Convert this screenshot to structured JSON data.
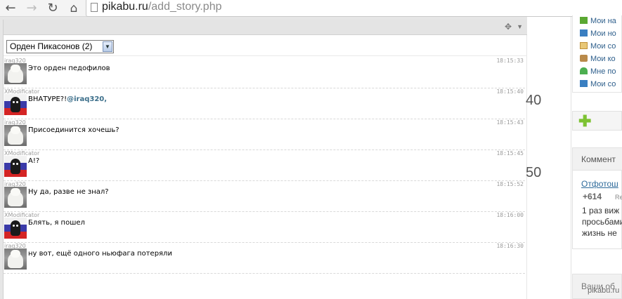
{
  "browser": {
    "url_domain": "pikabu.ru",
    "url_path": "/add_story.php",
    "back_glyph": "←",
    "forward_glyph": "→",
    "reload_glyph": "↻",
    "home_glyph": "⌂"
  },
  "chat": {
    "move_glyph": "✥",
    "menu_glyph": "▼",
    "room_selected": "Орден Пикасонов (2)",
    "select_arrow_glyph": "▼",
    "messages": [
      {
        "user": "iraq320",
        "time": "18:15:33",
        "text": "Это орден педофилов",
        "avatar": "polar-bear-avatar"
      },
      {
        "user": "XModificator",
        "time": "18:15:40",
        "text": "ВНАТУРЕ?!",
        "mention": "@iraq320,",
        "avatar": "skull-flag-avatar"
      },
      {
        "user": "iraq320",
        "time": "18:15:43",
        "text": "Присоединится хочешь?",
        "avatar": "polar-bear-avatar"
      },
      {
        "user": "XModificator",
        "time": "18:15:45",
        "text": "А!?",
        "avatar": "skull-flag-avatar"
      },
      {
        "user": "iraq320",
        "time": "18:15:52",
        "text": "Ну да, разве не знал?",
        "avatar": "polar-bear-avatar"
      },
      {
        "user": "XModificator",
        "time": "18:16:00",
        "text": "Блять, я пошел",
        "avatar": "skull-flag-avatar"
      },
      {
        "user": "iraq320",
        "time": "18:16:30",
        "text": "ну вот, ещё одного ньюфага потеряли",
        "avatar": "polar-bear-avatar"
      }
    ]
  },
  "side": {
    "number_1": "40",
    "number_2": "50",
    "links": [
      {
        "label": "Мои на",
        "icon": "star-icon",
        "color": "#5aa832"
      },
      {
        "label": "Мои но",
        "icon": "monitor-icon",
        "color": "#3a7fc1"
      },
      {
        "label": "Мои со",
        "icon": "envelope-icon",
        "color": "#d9a13b"
      },
      {
        "label": "Мои ко",
        "icon": "comment-icon",
        "color": "#b98a4a"
      },
      {
        "label": "Мне по",
        "icon": "thumb-up-icon",
        "color": "#4caf50"
      },
      {
        "label": "Мои со",
        "icon": "floppy-icon",
        "color": "#3a7fc1"
      }
    ],
    "add_glyph": "✚",
    "comments_title": "Коммент",
    "comment_author": "Отфотош",
    "comment_score": "+614",
    "comment_re": "Re",
    "comment_lines": [
      "1 раз виж",
      "просьбами",
      "жизнь не"
    ],
    "yours_title": "Ваши об",
    "watermark": "pikabu.ru"
  },
  "colors": {
    "link": "#2d5e8b",
    "mention": "#3b6e8a",
    "plus": "#7dc233"
  }
}
